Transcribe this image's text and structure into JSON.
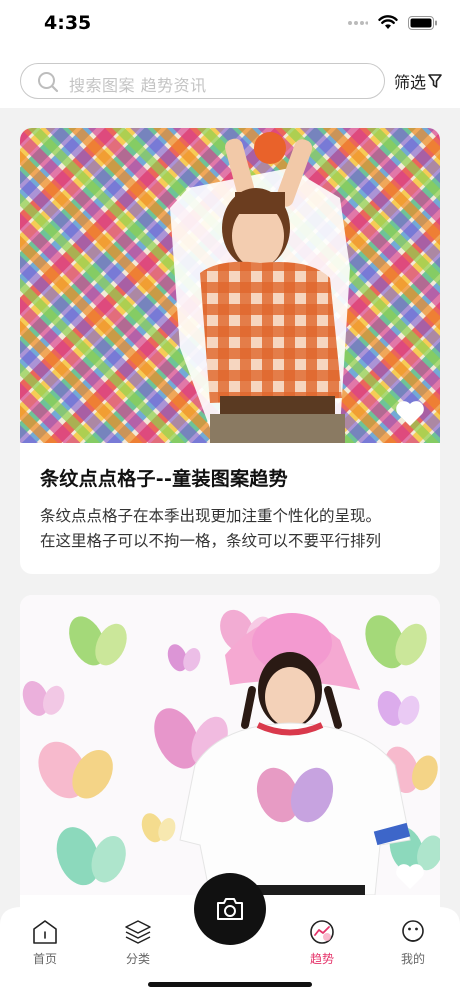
{
  "status_bar": {
    "time": "4:35"
  },
  "search": {
    "placeholder": "搜索图案 趋势资讯",
    "filter_label": "筛选"
  },
  "cards": [
    {
      "title": "条纹点点格子--童装图案趋势",
      "desc_line1": "条纹点点格子在本季出现更加注重个性化的呈现。",
      "desc_line2": "在这里格子可以不拘一格，条纹可以不要平行排列"
    },
    {
      "title": "",
      "desc_line1": "",
      "desc_line2": ""
    }
  ],
  "tabbar": {
    "home": "首页",
    "category": "分类",
    "trends": "趋势",
    "me": "我的"
  },
  "colors": {
    "accent": "#e5356b",
    "camera": "#111111"
  }
}
